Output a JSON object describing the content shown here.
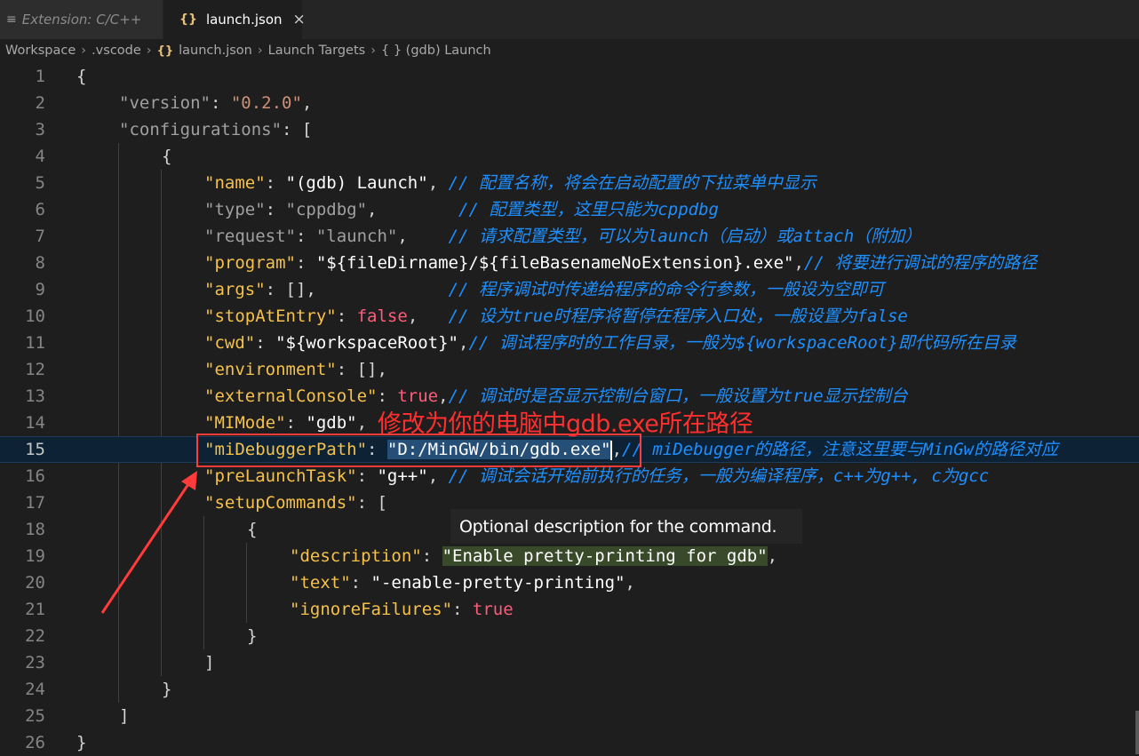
{
  "tabs": [
    {
      "icon": "≡",
      "label": "Extension: C/C++"
    },
    {
      "icon": "{}",
      "label": "launch.json",
      "close": "×"
    }
  ],
  "breadcrumb": [
    "Workspace",
    ".vscode",
    "launch.json",
    "Launch Targets",
    "{ } (gdb) Launch"
  ],
  "breadcrumb_sep": "›",
  "editor": {
    "line_numbers": [
      "1",
      "2",
      "3",
      "4",
      "5",
      "6",
      "7",
      "8",
      "9",
      "10",
      "11",
      "12",
      "13",
      "14",
      "15",
      "16",
      "17",
      "18",
      "19",
      "20",
      "21",
      "22",
      "23",
      "24",
      "25",
      "26"
    ],
    "lines": {
      "l1": "{",
      "l2_key": "\"version\"",
      "l2_val": "\"0.2.0\"",
      "l3_key": "\"configurations\"",
      "l3_rest": ": [",
      "l4": "{",
      "l5_key": "\"name\"",
      "l5_val": "\"(gdb) Launch\"",
      "l5_comment": "// 配置名称，将会在启动配置的下拉菜单中显示",
      "l6_key": "\"type\"",
      "l6_val": "\"cppdbg\"",
      "l6_comment": "// 配置类型，这里只能为cppdbg",
      "l7_key": "\"request\"",
      "l7_val": "\"launch\"",
      "l7_comment": "// 请求配置类型，可以为launch（启动）或attach（附加）",
      "l8_key": "\"program\"",
      "l8_val": "\"${fileDirname}/${fileBasenameNoExtension}.exe\"",
      "l8_comment": "// 将要进行调试的程序的路径",
      "l9_key": "\"args\"",
      "l9_val": "[]",
      "l9_comment": "// 程序调试时传递给程序的命令行参数，一般设为空即可",
      "l10_key": "\"stopAtEntry\"",
      "l10_val": "false",
      "l10_comment": "// 设为true时程序将暂停在程序入口处，一般设置为false",
      "l11_key": "\"cwd\"",
      "l11_val": "\"${workspaceRoot}\"",
      "l11_comment": "// 调试程序时的工作目录，一般为${workspaceRoot}即代码所在目录",
      "l12_key": "\"environment\"",
      "l12_val": "[]",
      "l13_key": "\"externalConsole\"",
      "l13_val": "true",
      "l13_comment": "// 调试时是否显示控制台窗口，一般设置为true显示控制台",
      "l14_key": "\"MIMode\"",
      "l14_val": "\"gdb\"",
      "l15_key": "\"miDebuggerPath\"",
      "l15_val": "\"D:/MinGW/bin/gdb.exe\"",
      "l15_comment": "// miDebugger的路径，注意这里要与MinGw的路径对应",
      "l16_key": "\"preLaunchTask\"",
      "l16_val": "\"g++\"",
      "l16_comment": "// 调试会话开始前执行的任务，一般为编译程序，c++为g++, c为gcc",
      "l17_key": "\"setupCommands\"",
      "l17_rest": ": [",
      "l18": "{",
      "l19_key": "\"description\"",
      "l19_val": "\"Enable pretty-printing for gdb\"",
      "l20_key": "\"text\"",
      "l20_val": "\"-enable-pretty-printing\"",
      "l21_key": "\"ignoreFailures\"",
      "l21_val": "true",
      "l22": "}",
      "l23": "]",
      "l24": "}",
      "l25": "]",
      "l26": "}"
    }
  },
  "annotation": {
    "note": "修改为你的电脑中gdb.exe所在路径",
    "color": "#ff2f2f"
  },
  "tooltip": "Optional description for the command.",
  "colors": {
    "background": "#1e1e1e",
    "key": "#9cdcfe",
    "string": "#ce9178",
    "boolean": "#ff5c7a",
    "comment": "#1e8fff"
  }
}
